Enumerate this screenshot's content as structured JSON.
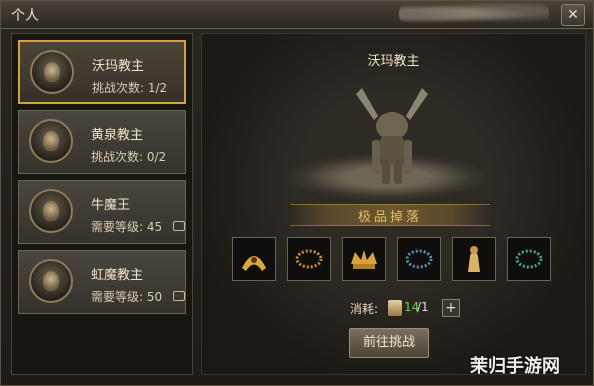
{
  "window": {
    "title": "个人",
    "close_label": "✕"
  },
  "bosses": [
    {
      "name": "沃玛教主",
      "sub": "挑战次数: 1/2",
      "selected": true,
      "locked": false
    },
    {
      "name": "黄泉教主",
      "sub": "挑战次数: 0/2",
      "selected": false,
      "locked": false
    },
    {
      "name": "牛魔王",
      "sub": "需要等级: 45",
      "selected": false,
      "locked": true
    },
    {
      "name": "虹魔教主",
      "sub": "需要等级: 50",
      "selected": false,
      "locked": true
    }
  ],
  "detail": {
    "boss_title": "沃玛教主",
    "drop_title": "极品掉落",
    "items": [
      {
        "icon": "helmet-icon",
        "color": "#d8a93a"
      },
      {
        "icon": "bracelet-icon",
        "color": "#c1903c"
      },
      {
        "icon": "crown-icon",
        "color": "#d9a23a"
      },
      {
        "icon": "bracelet-icon",
        "color": "#5b8fae"
      },
      {
        "icon": "figure-icon",
        "color": "#d8b36a"
      },
      {
        "icon": "bracelet-icon",
        "color": "#4aa57a"
      }
    ],
    "cost_label": "消耗:",
    "cost_have": "14",
    "cost_total": "/1",
    "add_label": "+",
    "challenge_label": "前往挑战"
  },
  "watermark": "茉归手游网"
}
